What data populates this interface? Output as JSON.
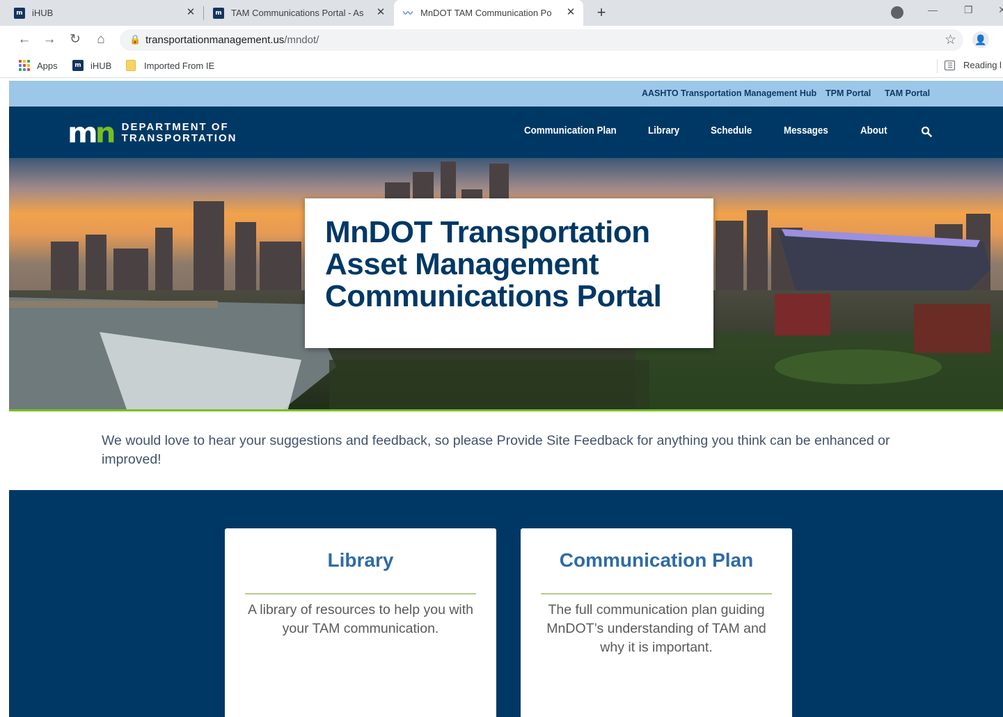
{
  "browser": {
    "tabs": [
      {
        "title": "iHUB",
        "favicon": "mn"
      },
      {
        "title": "TAM Communications Portal - As",
        "favicon": "mn"
      },
      {
        "title": "MnDOT TAM Communication Po",
        "favicon": "tam"
      }
    ],
    "url_host": "transportationmanagement.us",
    "url_path": "/mndot/",
    "bookmarks": [
      {
        "label": "Apps",
        "icon": "apps-grid-icon"
      },
      {
        "label": "iHUB",
        "icon": "mn"
      },
      {
        "label": "Imported From IE",
        "icon": "folder-icon"
      }
    ],
    "reading_list": "Reading l"
  },
  "site": {
    "top_links": [
      "AASHTO Transportation Management Hub",
      "TPM Portal",
      "TAM Portal"
    ],
    "logo": {
      "mark": "mn",
      "line1": "DEPARTMENT OF",
      "line2": "TRANSPORTATION"
    },
    "nav": [
      "Communication Plan",
      "Library",
      "Schedule",
      "Messages",
      "About"
    ],
    "hero_title_lines": [
      "MnDOT Transportation",
      "Asset Management",
      "Communications Portal"
    ],
    "feedback": "We would love to hear your suggestions and feedback, so please Provide Site Feedback for anything you think can be enhanced or improved!",
    "cards": [
      {
        "title": "Library",
        "text": "A library of resources to help you with your TAM communication."
      },
      {
        "title": "Communication Plan",
        "text": "The full communication plan guiding MnDOT’s understanding of TAM and why it is important."
      }
    ]
  },
  "colors": {
    "navy": "#003865",
    "top_strip": "#9dc7e8",
    "green_accent": "#78be21",
    "card_title": "#2e6ba6"
  }
}
